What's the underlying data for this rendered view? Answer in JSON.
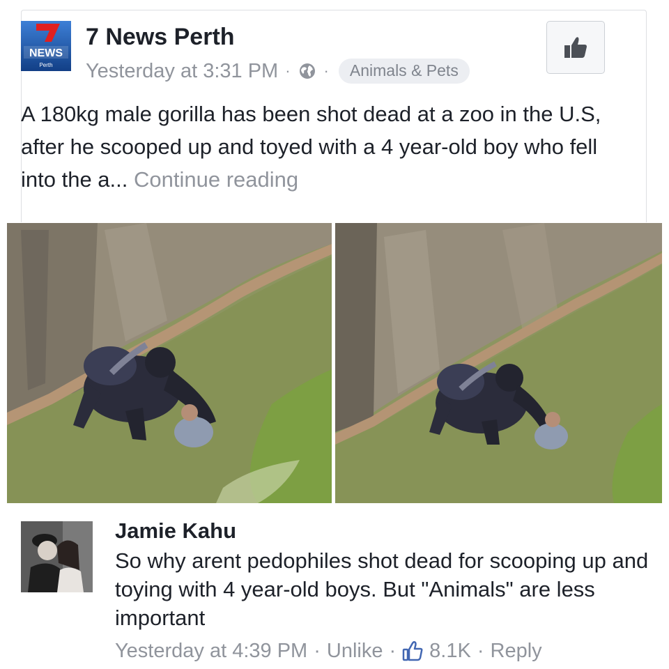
{
  "post": {
    "page_name": "7 News Perth",
    "logo": {
      "word": "NEWS",
      "sub": "Perth",
      "numeral": "7"
    },
    "timestamp": "Yesterday at 3:31 PM",
    "privacy_icon": "globe-icon",
    "separator": "·",
    "category": "Animals & Pets",
    "text": "A 180kg male gorilla has been shot dead at a zoo in the U.S, after he scooped up and toyed with a 4 year-old boy who fell into the a...",
    "continue_label": "Continue reading",
    "like_button_icon": "thumbs-up-icon"
  },
  "comment": {
    "author": "Jamie Kahu",
    "text": "So why arent pedophiles shot dead for scooping up and toying with 4 year-old boys. But \"Animals\" are less important",
    "timestamp": "Yesterday at 4:39 PM",
    "separator": "·",
    "unlike_label": "Unlike",
    "like_count": "8.1K",
    "reply_label": "Reply"
  },
  "colors": {
    "text": "#1d2129",
    "muted": "#90949c",
    "facebook_blue": "#4267b2",
    "news_red": "#e02020",
    "news_blue": "#1f5fae"
  }
}
